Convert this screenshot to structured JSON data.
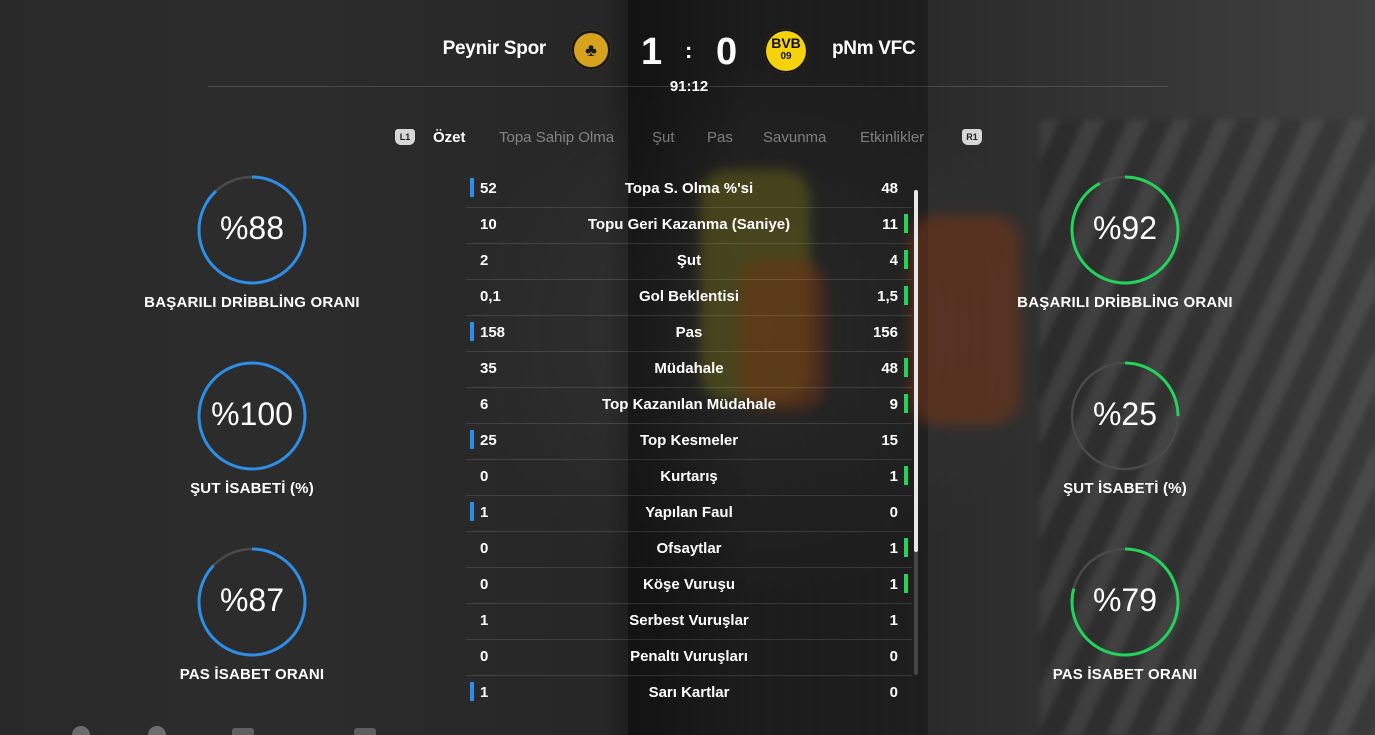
{
  "scoreboard": {
    "home_team": "Peynir Spor",
    "away_team": "pNm VFC",
    "home_score": "1",
    "away_score": "0",
    "separator": ":",
    "clock": "91:12",
    "home_crest_color": "#d7a21e",
    "away_crest_color": "#f6d20d",
    "away_crest_text": "BVB",
    "away_crest_number": "09"
  },
  "tabs": {
    "left_bumper": "L1",
    "right_bumper": "R1",
    "items": [
      "Özet",
      "Topa Sahip Olma",
      "Şut",
      "Pas",
      "Savunma",
      "Etkinlikler"
    ],
    "active": "Özet"
  },
  "home_rings": [
    {
      "value": "%88",
      "label": "BAŞARILI DRİBBLİNG ORANI",
      "fraction": 0.88
    },
    {
      "value": "%100",
      "label": "ŞUT İSABETİ (%)",
      "fraction": 1.0
    },
    {
      "value": "%87",
      "label": "PAS İSABET ORANI",
      "fraction": 0.87
    }
  ],
  "away_rings": [
    {
      "value": "%92",
      "label": "BAŞARILI DRİBBLİNG ORANI",
      "fraction": 0.92
    },
    {
      "value": "%25",
      "label": "ŞUT İSABETİ (%)",
      "fraction": 0.25
    },
    {
      "value": "%79",
      "label": "PAS İSABET ORANI",
      "fraction": 0.79
    }
  ],
  "stats": [
    {
      "name": "Topa S. Olma %'si",
      "home": "52",
      "away": "48",
      "leader": "home"
    },
    {
      "name": "Topu Geri Kazanma (Saniye)",
      "home": "10",
      "away": "11",
      "leader": "away"
    },
    {
      "name": "Şut",
      "home": "2",
      "away": "4",
      "leader": "away"
    },
    {
      "name": "Gol Beklentisi",
      "home": "0,1",
      "away": "1,5",
      "leader": "away"
    },
    {
      "name": "Pas",
      "home": "158",
      "away": "156",
      "leader": "home"
    },
    {
      "name": "Müdahale",
      "home": "35",
      "away": "48",
      "leader": "away"
    },
    {
      "name": "Top Kazanılan Müdahale",
      "home": "6",
      "away": "9",
      "leader": "away"
    },
    {
      "name": "Top Kesmeler",
      "home": "25",
      "away": "15",
      "leader": "home"
    },
    {
      "name": "Kurtarış",
      "home": "0",
      "away": "1",
      "leader": "away"
    },
    {
      "name": "Yapılan Faul",
      "home": "1",
      "away": "0",
      "leader": "home"
    },
    {
      "name": "Ofsaytlar",
      "home": "0",
      "away": "1",
      "leader": "away"
    },
    {
      "name": "Köşe Vuruşu",
      "home": "0",
      "away": "1",
      "leader": "away"
    },
    {
      "name": "Serbest Vuruşlar",
      "home": "1",
      "away": "1",
      "leader": "none"
    },
    {
      "name": "Penaltı Vuruşları",
      "home": "0",
      "away": "0",
      "leader": "none"
    },
    {
      "name": "Sarı Kartlar",
      "home": "1",
      "away": "0",
      "leader": "home"
    }
  ],
  "colors": {
    "home_accent": "#2d8fe8",
    "away_accent": "#22d45a",
    "ring_track": "#4a4a4a"
  }
}
